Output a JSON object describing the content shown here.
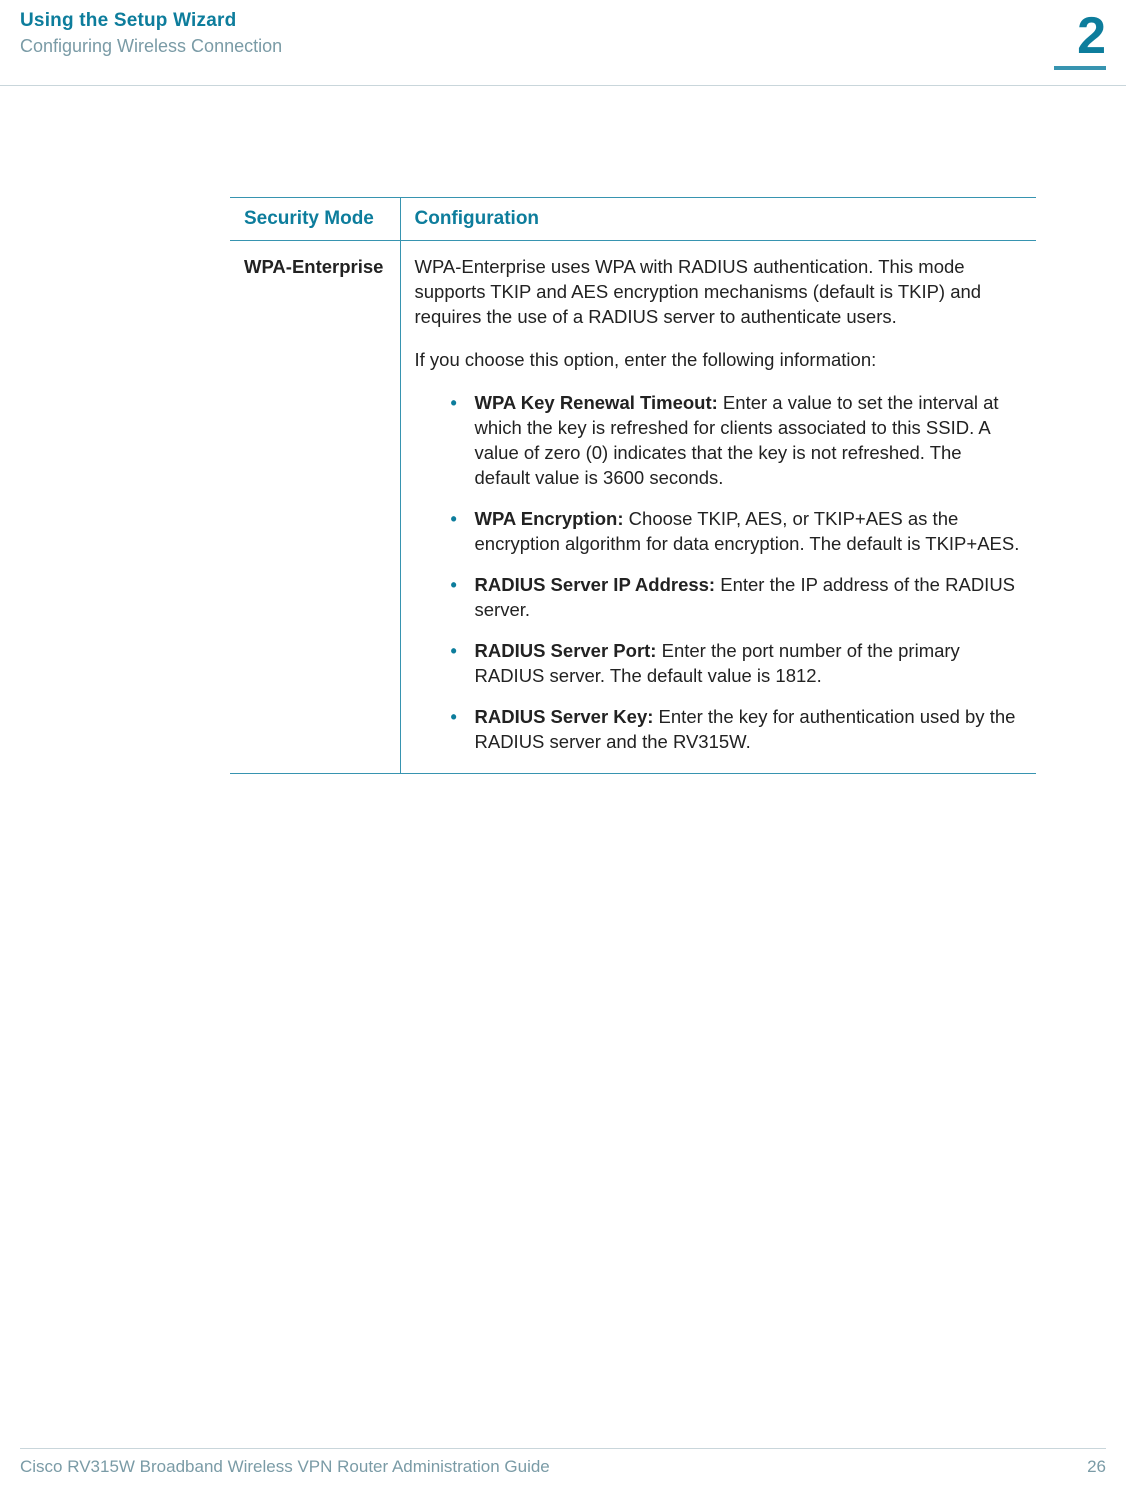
{
  "header": {
    "title": "Using the Setup Wizard",
    "subtitle": "Configuring Wireless Connection",
    "chapter": "2"
  },
  "table": {
    "headers": {
      "mode": "Security Mode",
      "config": "Configuration"
    },
    "row": {
      "mode": "WPA-Enterprise",
      "intro": "WPA-Enterprise uses WPA with RADIUS authentication. This mode supports TKIP and AES encryption mechanisms (default is TKIP) and requires the use of a RADIUS server to authenticate users.",
      "prompt": "If you choose this option, enter the following information:",
      "bullets": [
        {
          "label": "WPA Key Renewal Timeout:",
          "text": " Enter a value to set the interval at which the key is refreshed for clients associated to this SSID. A value of zero (0) indicates that the key is not refreshed. The default value is 3600 seconds."
        },
        {
          "label": "WPA Encryption:",
          "text": " Choose TKIP, AES, or TKIP+AES as the encryption algorithm for data encryption. The default is TKIP+AES."
        },
        {
          "label": "RADIUS Server IP Address:",
          "text": " Enter the IP address of the RADIUS server."
        },
        {
          "label": "RADIUS Server Port:",
          "text": " Enter the port number of the primary RADIUS server. The default value is 1812."
        },
        {
          "label": "RADIUS Server Key:",
          "text": " Enter the key for authentication used by the RADIUS server and the RV315W."
        }
      ]
    }
  },
  "footer": {
    "guide": "Cisco RV315W Broadband Wireless VPN Router Administration Guide",
    "page": "26"
  }
}
